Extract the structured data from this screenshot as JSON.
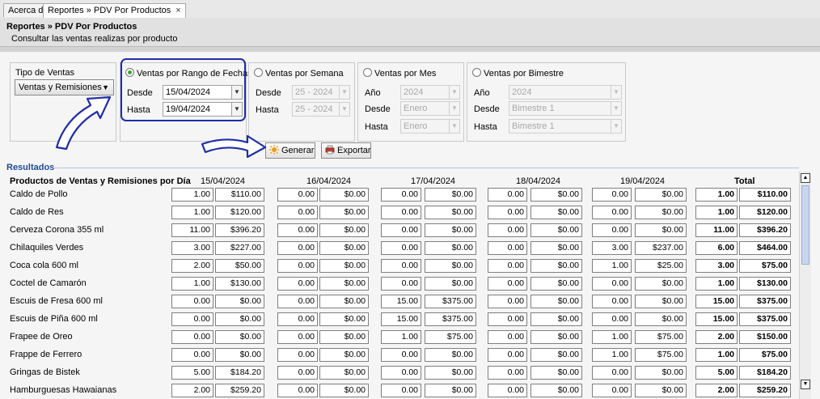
{
  "tabs": [
    {
      "label": "Acerca de",
      "close": ""
    },
    {
      "label": "Reportes » PDV Por Productos",
      "close": "×"
    }
  ],
  "header": {
    "title": "Reportes » PDV Por Productos",
    "subtitle": "Consultar las ventas realizas por producto"
  },
  "tipo_ventas": {
    "title": "Tipo de Ventas",
    "value": "Ventas y Remisiones"
  },
  "rango_fechas": {
    "title": "Ventas por Rango de Fechas",
    "desde_label": "Desde",
    "desde": "15/04/2024",
    "hasta_label": "Hasta",
    "hasta": "19/04/2024"
  },
  "semana": {
    "title": "Ventas por Semana",
    "desde_label": "Desde",
    "desde": "25 - 2024",
    "hasta_label": "Hasta",
    "hasta": "25 - 2024"
  },
  "mes": {
    "title": "Ventas por Mes",
    "anio_label": "Año",
    "anio": "2024",
    "desde_label": "Desde",
    "desde": "Enero",
    "hasta_label": "Hasta",
    "hasta": "Enero"
  },
  "bimestre": {
    "title": "Ventas por Bimestre",
    "anio_label": "Año",
    "anio": "2024",
    "desde_label": "Desde",
    "desde": "Bimestre 1",
    "hasta_label": "Hasta",
    "hasta": "Bimestre 1"
  },
  "buttons": {
    "generar": "Generar",
    "exportar": "Exportar"
  },
  "results": {
    "section_title": "Resultados",
    "product_header": "Productos de Ventas y Remisiones por Día",
    "date_headers": [
      "15/04/2024",
      "16/04/2024",
      "17/04/2024",
      "18/04/2024",
      "19/04/2024"
    ],
    "total_header": "Total",
    "rows": [
      {
        "name": "Caldo de Pollo",
        "cells": [
          "1.00",
          "$110.00",
          "0.00",
          "$0.00",
          "0.00",
          "$0.00",
          "0.00",
          "$0.00",
          "0.00",
          "$0.00"
        ],
        "total_qty": "1.00",
        "total_amt": "$110.00"
      },
      {
        "name": "Caldo de Res",
        "cells": [
          "1.00",
          "$120.00",
          "0.00",
          "$0.00",
          "0.00",
          "$0.00",
          "0.00",
          "$0.00",
          "0.00",
          "$0.00"
        ],
        "total_qty": "1.00",
        "total_amt": "$120.00"
      },
      {
        "name": "Cerveza Corona 355 ml",
        "cells": [
          "11.00",
          "$396.20",
          "0.00",
          "$0.00",
          "0.00",
          "$0.00",
          "0.00",
          "$0.00",
          "0.00",
          "$0.00"
        ],
        "total_qty": "11.00",
        "total_amt": "$396.20"
      },
      {
        "name": "Chilaquiles Verdes",
        "cells": [
          "3.00",
          "$227.00",
          "0.00",
          "$0.00",
          "0.00",
          "$0.00",
          "0.00",
          "$0.00",
          "3.00",
          "$237.00"
        ],
        "total_qty": "6.00",
        "total_amt": "$464.00"
      },
      {
        "name": "Coca cola 600 ml",
        "cells": [
          "2.00",
          "$50.00",
          "0.00",
          "$0.00",
          "0.00",
          "$0.00",
          "0.00",
          "$0.00",
          "1.00",
          "$25.00"
        ],
        "total_qty": "3.00",
        "total_amt": "$75.00"
      },
      {
        "name": "Coctel de Camarón",
        "cells": [
          "1.00",
          "$130.00",
          "0.00",
          "$0.00",
          "0.00",
          "$0.00",
          "0.00",
          "$0.00",
          "0.00",
          "$0.00"
        ],
        "total_qty": "1.00",
        "total_amt": "$130.00"
      },
      {
        "name": "Escuis de Fresa 600 ml",
        "cells": [
          "0.00",
          "$0.00",
          "0.00",
          "$0.00",
          "15.00",
          "$375.00",
          "0.00",
          "$0.00",
          "0.00",
          "$0.00"
        ],
        "total_qty": "15.00",
        "total_amt": "$375.00"
      },
      {
        "name": "Escuis de Piña 600 ml",
        "cells": [
          "0.00",
          "$0.00",
          "0.00",
          "$0.00",
          "15.00",
          "$375.00",
          "0.00",
          "$0.00",
          "0.00",
          "$0.00"
        ],
        "total_qty": "15.00",
        "total_amt": "$375.00"
      },
      {
        "name": "Frapee de Oreo",
        "cells": [
          "0.00",
          "$0.00",
          "0.00",
          "$0.00",
          "1.00",
          "$75.00",
          "0.00",
          "$0.00",
          "1.00",
          "$75.00"
        ],
        "total_qty": "2.00",
        "total_amt": "$150.00"
      },
      {
        "name": "Frappe de Ferrero",
        "cells": [
          "0.00",
          "$0.00",
          "0.00",
          "$0.00",
          "0.00",
          "$0.00",
          "0.00",
          "$0.00",
          "1.00",
          "$75.00"
        ],
        "total_qty": "1.00",
        "total_amt": "$75.00"
      },
      {
        "name": "Gringas de Bistek",
        "cells": [
          "5.00",
          "$184.20",
          "0.00",
          "$0.00",
          "0.00",
          "$0.00",
          "0.00",
          "$0.00",
          "0.00",
          "$0.00"
        ],
        "total_qty": "5.00",
        "total_amt": "$184.20"
      },
      {
        "name": "Hamburguesas Hawaianas",
        "cells": [
          "2.00",
          "$259.20",
          "0.00",
          "$0.00",
          "0.00",
          "$0.00",
          "0.00",
          "$0.00",
          "0.00",
          "$0.00"
        ],
        "total_qty": "2.00",
        "total_amt": "$259.20"
      }
    ]
  },
  "colors": {
    "accent_border": "#1f2ea8",
    "radio_on": "#38a832",
    "section_title": "#1f4d99"
  },
  "icons": {
    "generar": "sun-icon",
    "exportar": "printer-icon",
    "dropdown": "chevron-down-icon",
    "annotation": "curved-arrow-icon"
  }
}
